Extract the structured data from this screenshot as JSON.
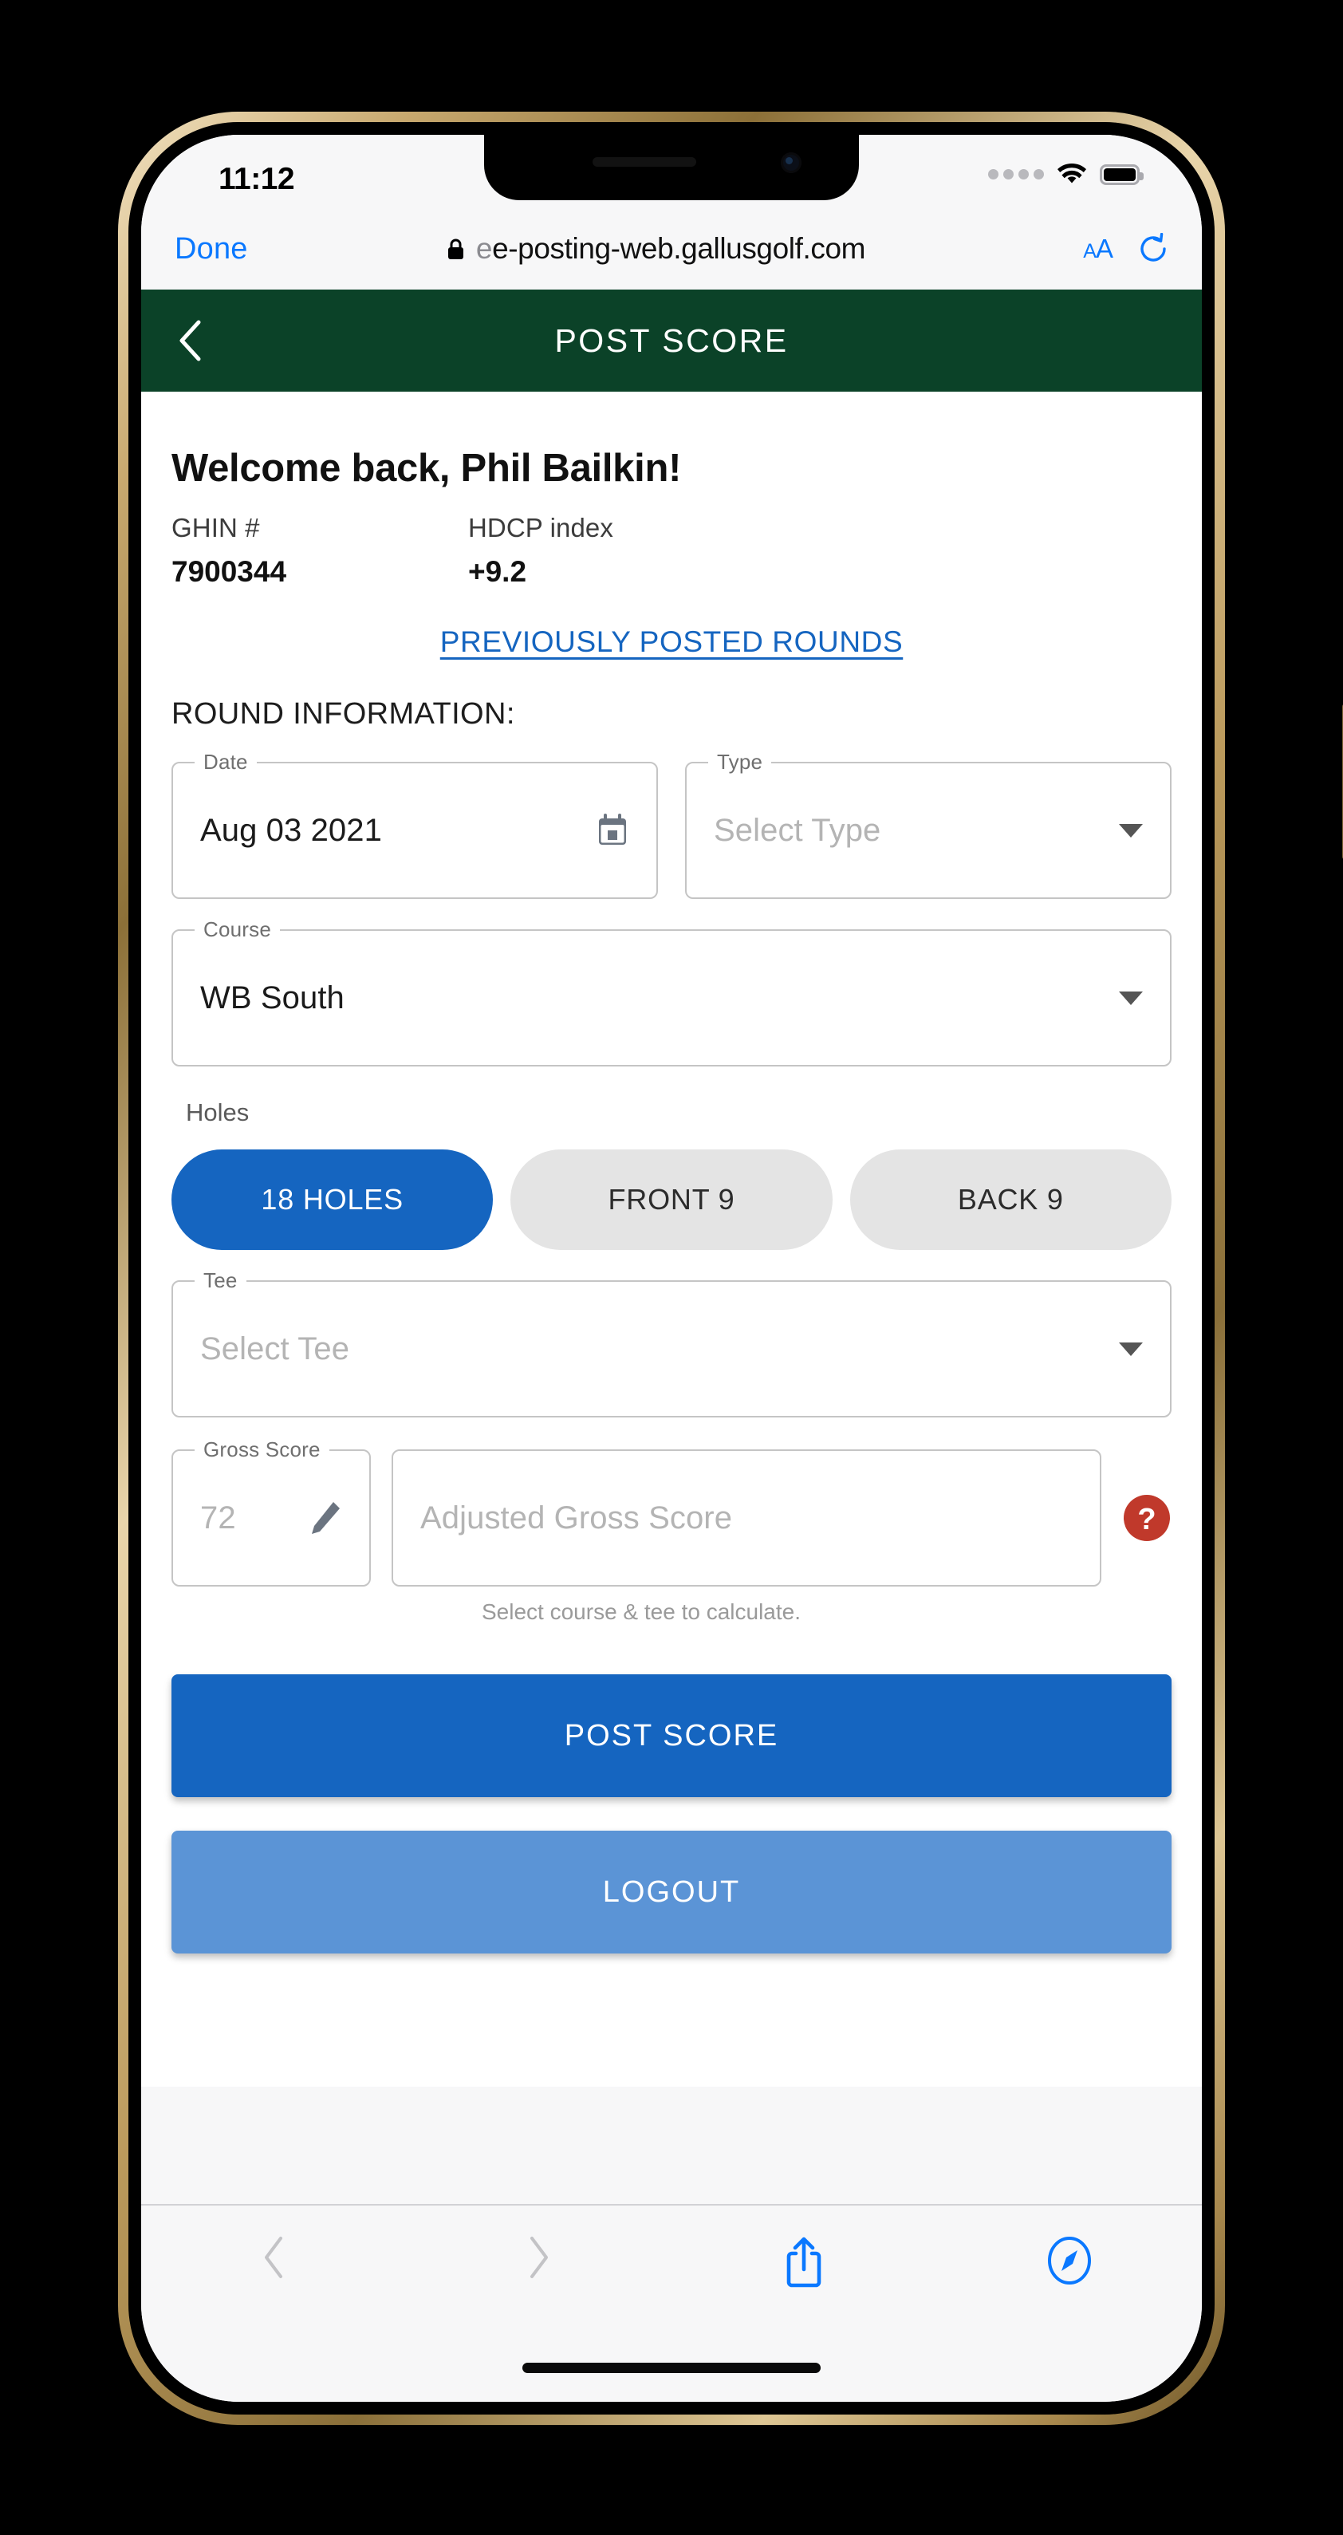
{
  "status_bar": {
    "time": "11:12",
    "signal_icon": "signal-dots-icon",
    "wifi_icon": "wifi-icon",
    "battery_icon": "battery-full-icon"
  },
  "browser": {
    "done_label": "Done",
    "lock_icon": "lock-icon",
    "url_prefix": "",
    "url": "e-posting-web.gallusgolf.com",
    "text_size_label": "AA",
    "reload_icon": "reload-icon",
    "toolbar": {
      "back_icon": "chevron-left-icon",
      "forward_icon": "chevron-right-icon",
      "share_icon": "share-icon",
      "tabs_icon": "safari-compass-icon"
    }
  },
  "app_header": {
    "back_icon": "chevron-left-icon",
    "title": "POST SCORE",
    "background_color": "#0b4228"
  },
  "main": {
    "welcome_title": "Welcome back, Phil Bailkin!",
    "ghin_label": "GHIN #",
    "ghin_value": "7900344",
    "hdcp_label": "HDCP index",
    "hdcp_value": "+9.2",
    "previous_rounds_link": "PREVIOUSLY POSTED ROUNDS",
    "round_info_heading": "ROUND INFORMATION:",
    "fields": {
      "date": {
        "legend": "Date",
        "value": "Aug 03 2021",
        "icon": "calendar-icon"
      },
      "type": {
        "legend": "Type",
        "value": "Select Type",
        "is_placeholder": true,
        "icon": "chevron-down-icon"
      },
      "course": {
        "legend": "Course",
        "value": "WB South",
        "icon": "chevron-down-icon"
      },
      "tee": {
        "legend": "Tee",
        "value": "Select Tee",
        "is_placeholder": true,
        "icon": "chevron-down-icon"
      },
      "gross_score": {
        "legend": "Gross Score",
        "placeholder": "72",
        "value": "",
        "icon": "pencil-icon"
      },
      "adjusted_gross_score": {
        "placeholder": "Adjusted Gross Score",
        "value": "",
        "help_icon": "help-circle-icon",
        "help_icon_color": "#c0392b"
      }
    },
    "holes": {
      "label": "Holes",
      "options": [
        {
          "label": "18 HOLES",
          "selected": true
        },
        {
          "label": "FRONT 9",
          "selected": false
        },
        {
          "label": "BACK 9",
          "selected": false
        }
      ]
    },
    "calc_helper_text": "Select course & tee to calculate.",
    "post_score_button": "POST SCORE",
    "logout_button": "LOGOUT"
  },
  "colors": {
    "header_green": "#0b4228",
    "primary_blue": "#1565c0",
    "logout_blue": "#5b94d6",
    "link_blue": "#1565c0",
    "safari_blue": "#0a78ff",
    "help_red": "#c0392b"
  }
}
